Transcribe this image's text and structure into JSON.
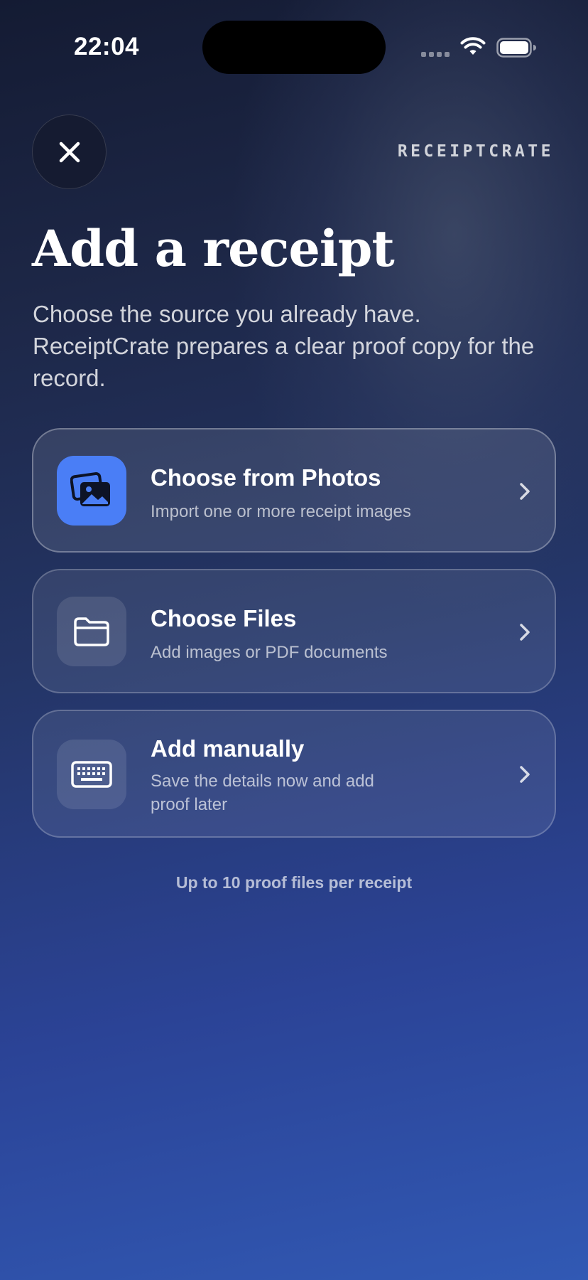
{
  "status_bar": {
    "time": "22:04"
  },
  "header": {
    "close_label": "Close",
    "brand": "RECEIPTCRATE"
  },
  "main": {
    "title": "Add a receipt",
    "subtitle": "Choose the source you already have. ReceiptCrate prepares a clear proof copy for the record."
  },
  "options": [
    {
      "icon": "photos-icon",
      "title": "Choose from Photos",
      "description": "Import one or more receipt images"
    },
    {
      "icon": "folder-icon",
      "title": "Choose Files",
      "description": "Add images or PDF documents"
    },
    {
      "icon": "keyboard-icon",
      "title": "Add manually",
      "description": "Save the details now and add proof later"
    }
  ],
  "footer": {
    "note": "Up to 10 proof files per receipt"
  },
  "colors": {
    "accent": "#4a7ef6",
    "background_top": "#141b33",
    "background_bottom": "#3159b4"
  }
}
